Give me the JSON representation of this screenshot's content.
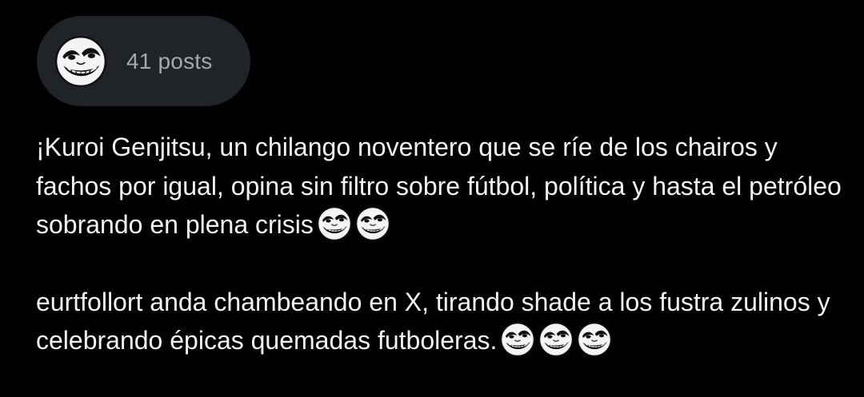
{
  "profile_chip": {
    "post_count": "41 posts",
    "avatar_icon": "troll-face-icon"
  },
  "bio": {
    "paragraph_1": "¡Kuroi Genjitsu, un chilango noventero que se ríe de los chairos y fachos por igual, opina sin filtro sobre fútbol, política y hasta el petróleo sobrando en plena crisis",
    "paragraph_1_emojis": [
      "troll-face-icon",
      "troll-face-icon"
    ],
    "paragraph_2": "eurtfollort anda chambeando en X, tirando shade a los fustra zulinos y celebrando épicas quemadas futboleras.",
    "paragraph_2_emojis": [
      "troll-face-icon",
      "troll-face-icon",
      "troll-face-icon"
    ]
  },
  "colors": {
    "background": "#000000",
    "chip_background": "#202327",
    "muted_text": "#a5a9ad",
    "primary_text": "#f1f3f4"
  }
}
